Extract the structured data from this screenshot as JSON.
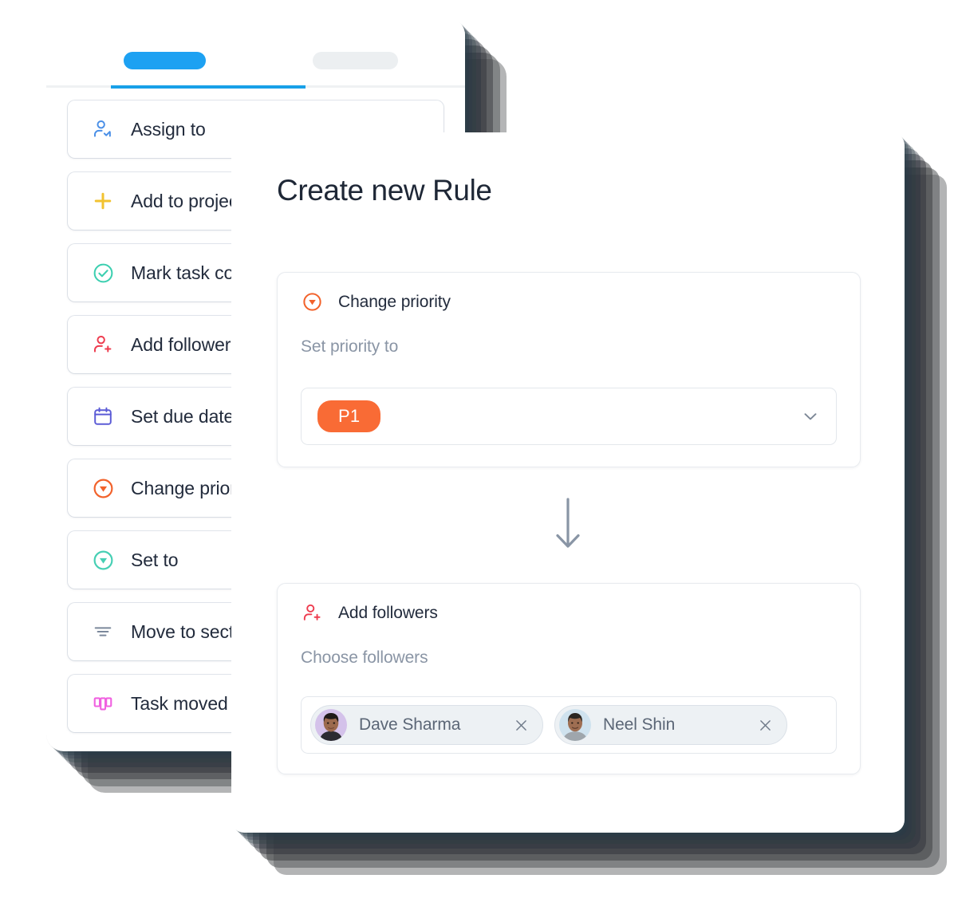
{
  "left_panel": {
    "tabs": [
      {
        "name": "tab-active",
        "label": "",
        "state": "active",
        "color": "#1DA1F2"
      },
      {
        "name": "tab-inactive",
        "label": "",
        "state": "inactive",
        "color": "#ECEFF1"
      }
    ],
    "actions": [
      {
        "label": "Assign to",
        "icon": "person-check-icon",
        "color": "#4A8FE7"
      },
      {
        "label": "Add to project",
        "icon": "plus-icon",
        "color": "#F2C230"
      },
      {
        "label": "Mark task complete",
        "icon": "check-circle-icon",
        "color": "#3CCFB0"
      },
      {
        "label": "Add followers",
        "icon": "person-plus-icon",
        "color": "#EE3B4E"
      },
      {
        "label": "Set due date",
        "icon": "calendar-icon",
        "color": "#5B5BD6"
      },
      {
        "label": "Change priority",
        "icon": "priority-down-icon",
        "color": "#F2622B"
      },
      {
        "label": "Set to",
        "icon": "status-down-icon",
        "color": "#46CFB4"
      },
      {
        "label": "Move to section",
        "icon": "sections-icon",
        "color": "#7B889B"
      },
      {
        "label": "Task moved to",
        "icon": "board-icon",
        "color": "#F061E0"
      }
    ]
  },
  "dialog": {
    "title": "Create new Rule",
    "trigger_card": {
      "icon": "priority-down-icon",
      "icon_color": "#F2622B",
      "title": "Change priority",
      "field_label": "Set priority to",
      "selected_value": "P1",
      "selected_color": "#F96B35",
      "chevron_icon": "chevron-down-icon"
    },
    "flow_arrow_icon": "arrow-down-icon",
    "action_card": {
      "icon": "person-plus-icon",
      "icon_color": "#EE3B4E",
      "title": "Add followers",
      "field_label": "Choose followers",
      "followers": [
        {
          "name": "Dave Sharma",
          "avatar_bg": "#D4C2EA",
          "remove_icon": "close-icon"
        },
        {
          "name": "Neel Shin",
          "avatar_bg": "#CFE2EE",
          "remove_icon": "close-icon"
        }
      ]
    }
  }
}
